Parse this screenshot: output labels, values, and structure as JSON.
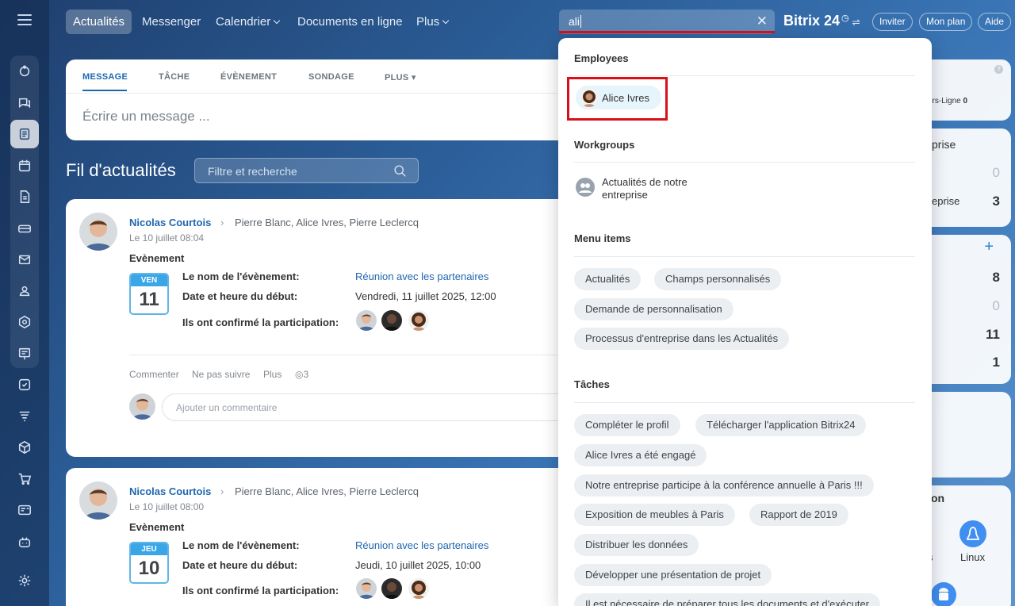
{
  "topnav": {
    "items": [
      {
        "label": "Actualités",
        "active": true
      },
      {
        "label": "Messenger"
      },
      {
        "label": "Calendrier",
        "chevron": true
      },
      {
        "label": "Documents en ligne"
      },
      {
        "label": "Plus",
        "chevron": true
      }
    ],
    "search_value": "ali",
    "brand": "Bitrix 24",
    "buttons": [
      "Inviter",
      "Mon plan",
      "Aide"
    ]
  },
  "composer": {
    "tabs": [
      "MESSAGE",
      "TÂCHE",
      "ÉVÈNEMENT",
      "SONDAGE",
      "PLUS"
    ],
    "placeholder": "Écrire un message ..."
  },
  "feed": {
    "title": "Fil d'actualités",
    "filter_placeholder": "Filtre et recherche",
    "posts": [
      {
        "author": "Nicolas Courtois",
        "recipients": "Pierre Blanc, Alice Ivres, Pierre Leclercq",
        "date": "Le 10 juillet 08:04",
        "type": "Evènement",
        "cal_day": "VEN",
        "cal_num": "11",
        "event_name_label": "Le nom de l'évènement:",
        "event_name": "Réunion avec les partenaires",
        "start_label": "Date et heure du début:",
        "start": "Vendredi, 11 juillet 2025, 12:00",
        "confirmed_label": "Ils ont confirmé la participation:",
        "actions": {
          "comment": "Commenter",
          "unfollow": "Ne pas suivre",
          "more": "Plus",
          "views": "3"
        },
        "comment_placeholder": "Ajouter un commentaire"
      },
      {
        "author": "Nicolas Courtois",
        "recipients": "Pierre Blanc, Alice Ivres, Pierre Leclercq",
        "date": "Le 10 juillet 08:00",
        "type": "Evènement",
        "cal_day": "JEU",
        "cal_num": "10",
        "event_name_label": "Le nom de l'évènement:",
        "event_name": "Réunion avec les partenaires",
        "start_label": "Date et heure du début:",
        "start": "Jeudi, 10 juillet 2025, 10:00",
        "confirmed_label": "Ils ont confirmé la participation:"
      }
    ]
  },
  "side": {
    "offline_label": "ors-Ligne",
    "offline_count": "0",
    "proc_title": "prise",
    "proc_row1_count": "0",
    "proc_row2_label": "eprise",
    "proc_row2_count": "3",
    "plus": "+",
    "tasks_counts": [
      "8",
      "0",
      "11",
      "1"
    ],
    "link_fragment": "t",
    "apps_title": "on",
    "app_s": "s",
    "app_linux": "Linux"
  },
  "dropdown": {
    "employees_heading": "Employees",
    "employee": "Alice Ivres",
    "workgroups_heading": "Workgroups",
    "workgroup": "Actualités de notre entreprise",
    "menu_heading": "Menu items",
    "menu_items": [
      "Actualités",
      "Champs personnalisés",
      "Demande de personnalisation",
      "Processus d'entreprise dans les Actualités"
    ],
    "tasks_heading": "Tâches",
    "tasks": [
      "Compléter le profil",
      "Télécharger l'application Bitrix24",
      "Alice Ivres a été engagé",
      "Notre entreprise participe à la conférence annuelle à Paris !!!",
      "Exposition de meubles à Paris",
      "Rapport de 2019",
      "Distribuer les données",
      "Développer une présentation de projet",
      "Il est nécessaire de préparer tous les documents et d'exécuter"
    ]
  }
}
